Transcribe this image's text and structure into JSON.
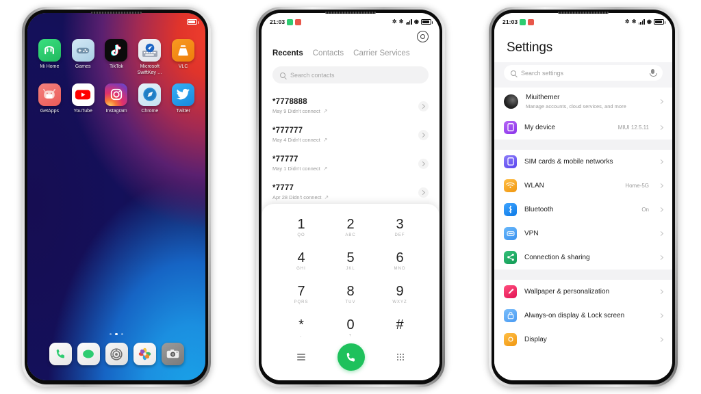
{
  "scene": {
    "description": "Three smartphone mockups side by side",
    "accent_green": "#1ec15c",
    "accent_blue": "#1a8cff"
  },
  "status_bar": {
    "time": "21:03",
    "icons": [
      "green-chip",
      "red-chip",
      "bluetooth-icon",
      "silent-icon",
      "signal-bars-icon",
      "wifi-icon",
      "battery-icon"
    ],
    "bluetooth_glyph": "✲",
    "silent_glyph": "✼",
    "wifi_glyph": "◥"
  },
  "phone1": {
    "name": "Home screen",
    "apps_row1": [
      {
        "label": "Mi Home",
        "icon": "mi-home-icon",
        "bg": "#2ecc71",
        "glyph": "M"
      },
      {
        "label": "Games",
        "icon": "games-icon",
        "bg": "#bfdcee",
        "glyph": "🎮"
      },
      {
        "label": "TikTok",
        "icon": "tiktok-icon",
        "bg": "#0d0d0d",
        "glyph": "♪"
      },
      {
        "label": "Microsoft SwiftKey …",
        "icon": "swiftkey-icon",
        "bg": "#e8eaee",
        "glyph": "⌨"
      },
      {
        "label": "VLC",
        "icon": "vlc-icon",
        "bg": "#f08116",
        "glyph": "▲"
      }
    ],
    "apps_row2": [
      {
        "label": "GetApps",
        "icon": "getapps-icon",
        "bg": "#f0635e",
        "glyph": "◉"
      },
      {
        "label": "YouTube",
        "icon": "youtube-icon",
        "bg": "#ffffff",
        "glyph": "▶"
      },
      {
        "label": "Instagram",
        "icon": "instagram-icon",
        "bg": "#d6249f",
        "glyph": "◎"
      },
      {
        "label": "Chrome",
        "icon": "chrome-icon",
        "bg": "#d9edf7",
        "glyph": "➤"
      },
      {
        "label": "Twitter",
        "icon": "twitter-icon",
        "bg": "#1d9bf0",
        "glyph": "🐦"
      }
    ],
    "page_dots": {
      "count": 3,
      "active_index": 1
    },
    "dock": [
      {
        "label": "Phone",
        "icon": "phone-dock-icon",
        "bg": "#ffffff",
        "glyph": "📞"
      },
      {
        "label": "Messages",
        "icon": "messages-dock-icon",
        "bg": "#ffffff",
        "glyph": "●"
      },
      {
        "label": "Settings",
        "icon": "settings-dock-icon",
        "bg": "#f0f0f0",
        "glyph": "◎"
      },
      {
        "label": "Photos",
        "icon": "photos-dock-icon",
        "bg": "#ffffff",
        "glyph": "✿"
      },
      {
        "label": "Camera",
        "icon": "camera-dock-icon",
        "bg": "#8d8d8d",
        "glyph": "📷"
      }
    ]
  },
  "phone2": {
    "name": "Phone / Dialer app",
    "settings_icon": "gear-icon",
    "tabs": [
      {
        "label": "Recents",
        "active": true
      },
      {
        "label": "Contacts",
        "active": false
      },
      {
        "label": "Carrier Services",
        "active": false
      }
    ],
    "search": {
      "placeholder": "Search contacts",
      "icon": "search-icon"
    },
    "calls": [
      {
        "number": "*7778888",
        "detail": "May 9 Didn't connect"
      },
      {
        "number": "*777777",
        "detail": "May 4 Didn't connect"
      },
      {
        "number": "*77777",
        "detail": "May 1 Didn't connect"
      },
      {
        "number": "*7777",
        "detail": "Apr 28 Didn't connect"
      }
    ],
    "keypad": [
      {
        "digit": "1",
        "sub": "QO"
      },
      {
        "digit": "2",
        "sub": "ABC"
      },
      {
        "digit": "3",
        "sub": "DEF"
      },
      {
        "digit": "4",
        "sub": "GHI"
      },
      {
        "digit": "5",
        "sub": "JKL"
      },
      {
        "digit": "6",
        "sub": "MNO"
      },
      {
        "digit": "7",
        "sub": "PQRS"
      },
      {
        "digit": "8",
        "sub": "TUV"
      },
      {
        "digit": "9",
        "sub": "WXYZ"
      },
      {
        "digit": "*",
        "sub": ","
      },
      {
        "digit": "0",
        "sub": "+"
      },
      {
        "digit": "#",
        "sub": ""
      }
    ],
    "actions": {
      "menu_icon": "hamburger-menu-icon",
      "call_icon": "call-button-icon",
      "call_glyph": "📞",
      "dialpad_icon": "dialpad-icon"
    }
  },
  "phone3": {
    "name": "Settings app",
    "title": "Settings",
    "search": {
      "placeholder": "Search settings",
      "icon": "search-icon",
      "mic": "microphone-icon"
    },
    "account": {
      "name": "Miuithemer",
      "subtitle": "Manage accounts, cloud services, and more",
      "icon": "account-avatar"
    },
    "groups": [
      {
        "rows": [
          {
            "label": "My device",
            "value": "MIUI 12.5.11",
            "icon": "device-icon",
            "bg": "#a24ff0"
          }
        ]
      },
      {
        "rows": [
          {
            "label": "SIM cards & mobile networks",
            "value": "",
            "icon": "sim-card-icon",
            "bg": "#6e5cf2"
          },
          {
            "label": "WLAN",
            "value": "Home-5G",
            "icon": "wifi-settings-icon",
            "bg": "#f5a623"
          },
          {
            "label": "Bluetooth",
            "value": "On",
            "icon": "bluetooth-settings-icon",
            "bg": "#1a8cff"
          },
          {
            "label": "VPN",
            "value": "",
            "icon": "vpn-icon",
            "bg": "#4aa3f5"
          },
          {
            "label": "Connection & sharing",
            "value": "",
            "icon": "share-icon",
            "bg": "#1fa85c"
          }
        ]
      },
      {
        "rows": [
          {
            "label": "Wallpaper & personalization",
            "value": "",
            "icon": "wallpaper-icon",
            "bg": "#ef2e63"
          },
          {
            "label": "Always-on display & Lock screen",
            "value": "",
            "icon": "lock-icon",
            "bg": "#5aaef7"
          },
          {
            "label": "Display",
            "value": "",
            "icon": "display-icon",
            "bg": "#f5a623"
          }
        ]
      }
    ]
  }
}
